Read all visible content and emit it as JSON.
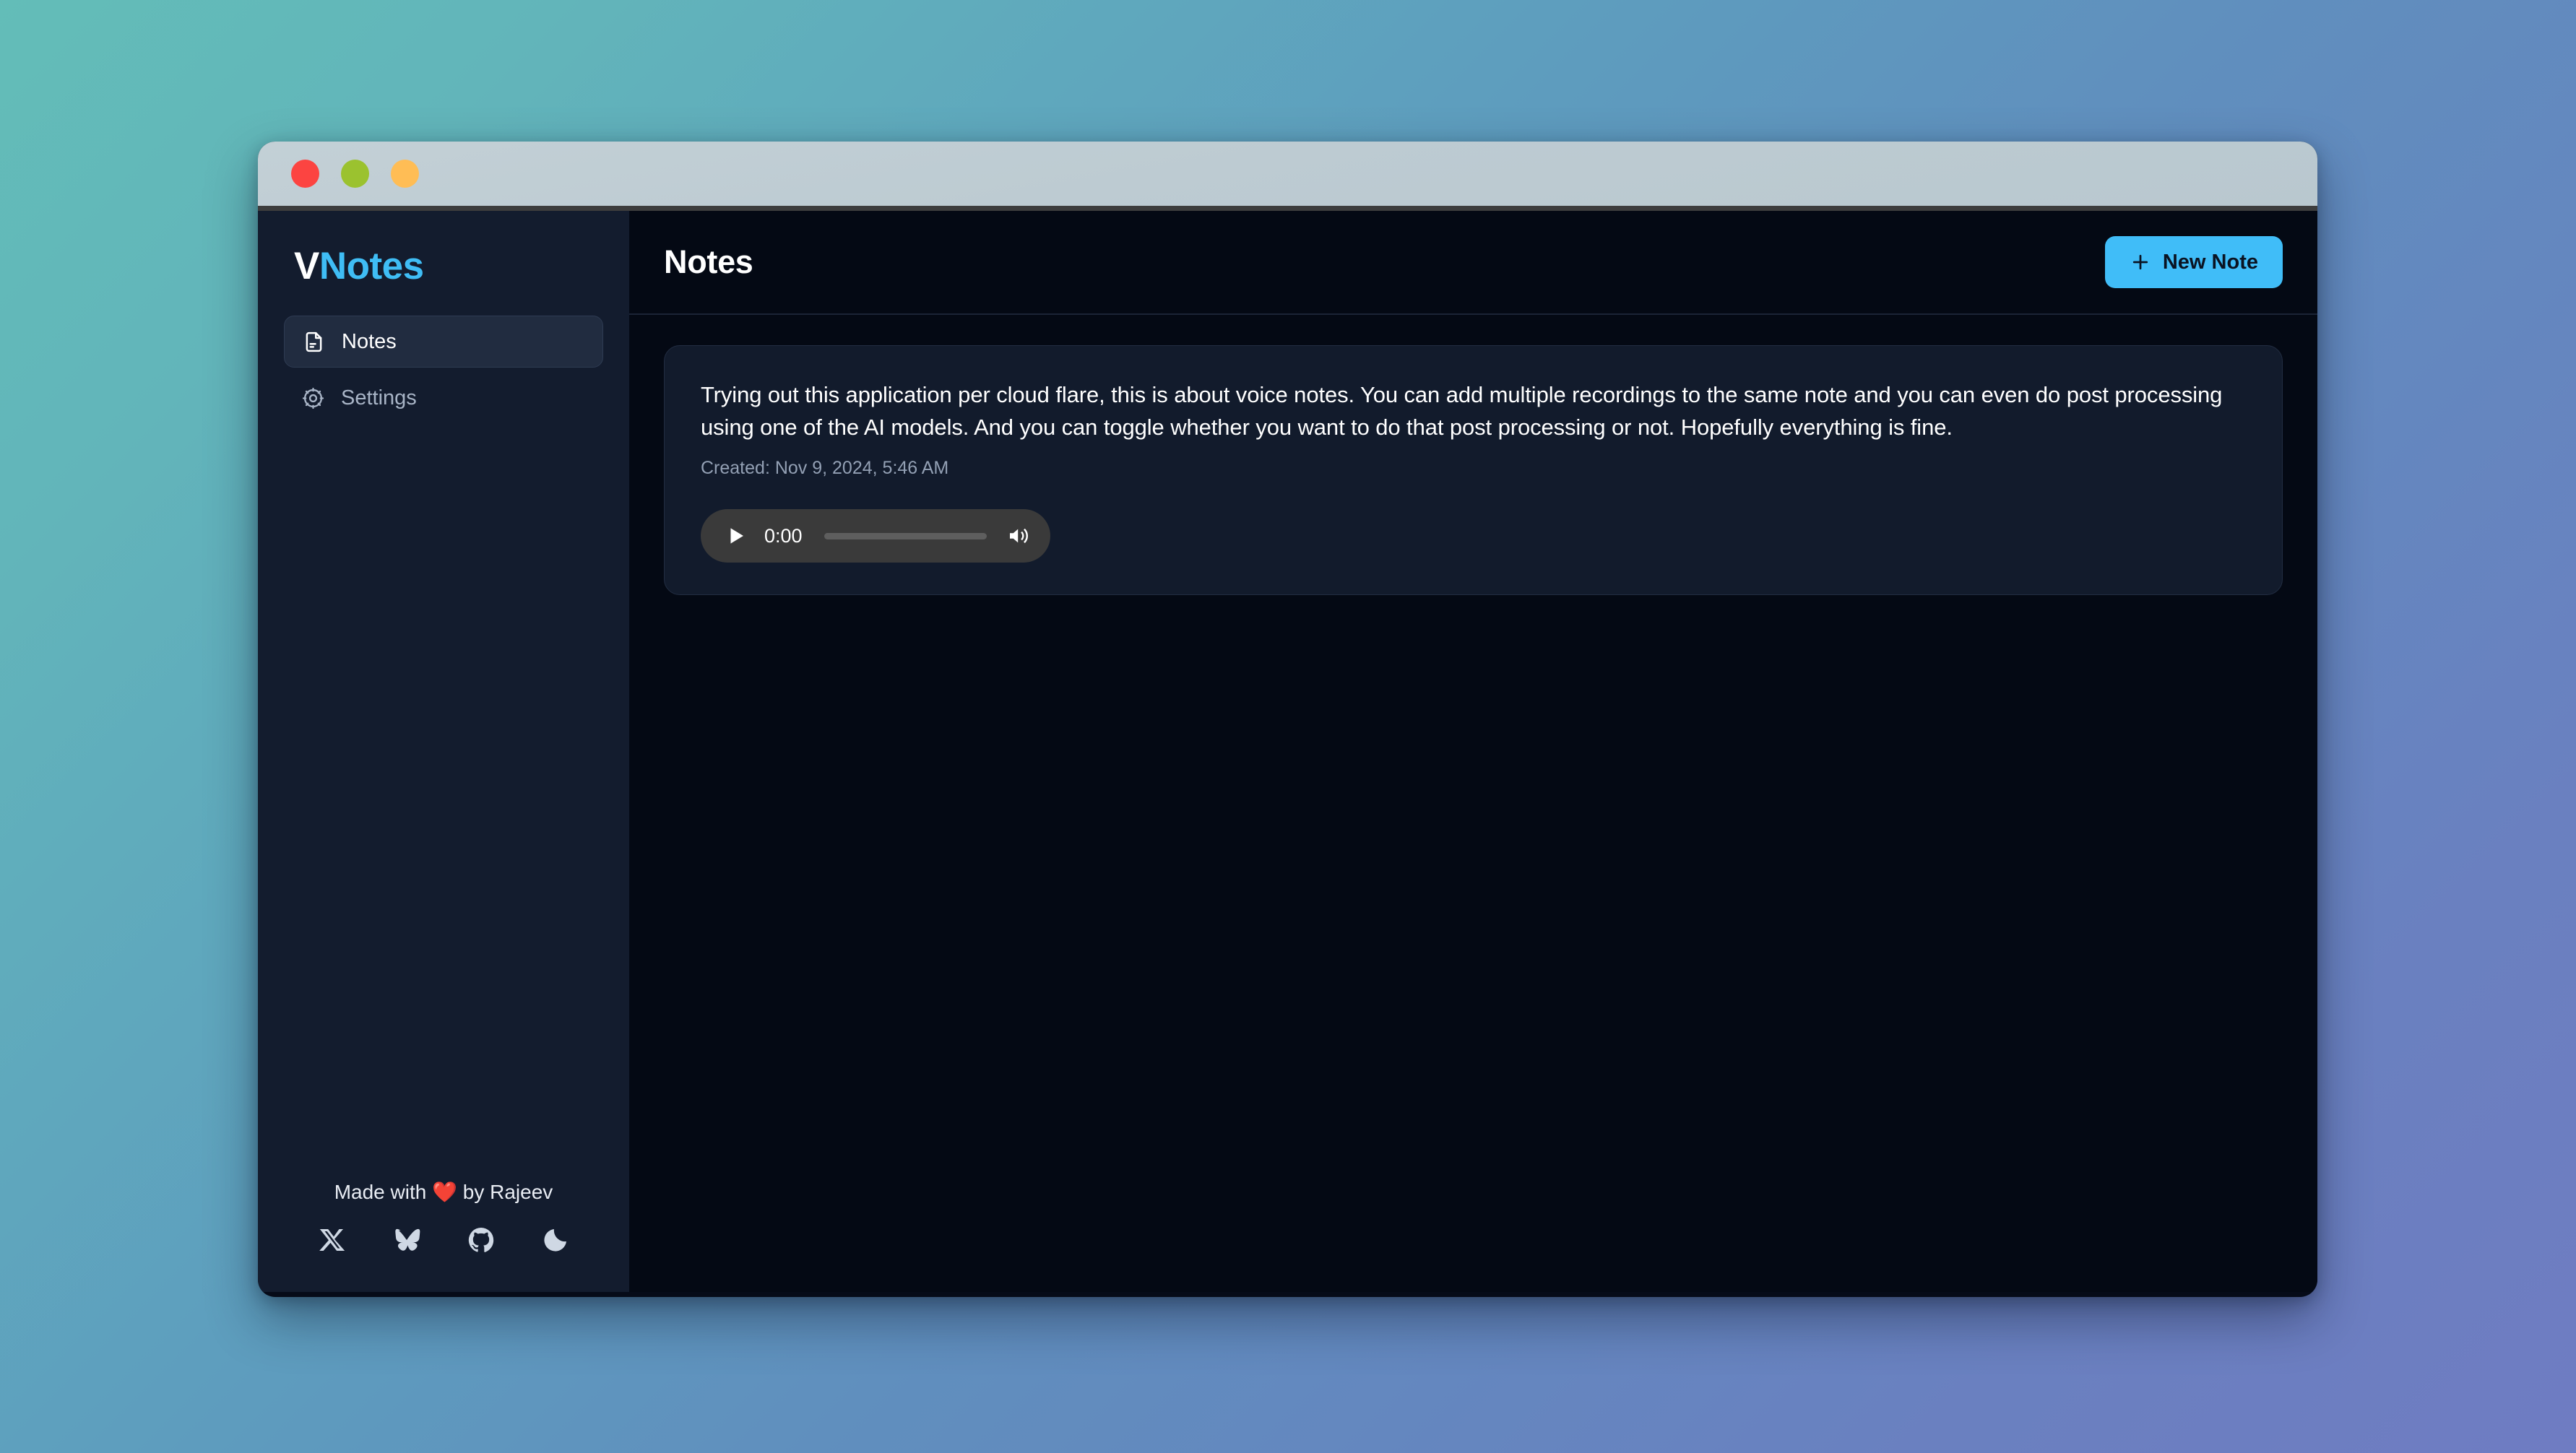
{
  "window": {
    "traffic_lights": [
      {
        "name": "close",
        "color": "#fc4441"
      },
      {
        "name": "minimize",
        "color": "#9bc22f"
      },
      {
        "name": "zoom",
        "color": "#ffbd55"
      }
    ]
  },
  "sidebar": {
    "brand": {
      "prefix": "V",
      "suffix": "Notes",
      "accent_color": "#3fbdf5"
    },
    "items": [
      {
        "label": "Notes",
        "icon": "document-icon",
        "active": true
      },
      {
        "label": "Settings",
        "icon": "gear-icon",
        "active": false
      }
    ],
    "footer": {
      "made_with_prefix": "Made with ",
      "heart": "❤️",
      "made_with_suffix": " by Rajeev",
      "socials": [
        {
          "name": "x-twitter-icon",
          "label": "X"
        },
        {
          "name": "bluesky-icon",
          "label": "Bluesky"
        },
        {
          "name": "github-icon",
          "label": "GitHub"
        },
        {
          "name": "moon-icon",
          "label": "Dark mode"
        }
      ]
    }
  },
  "header": {
    "title": "Notes",
    "new_note_label": "New Note",
    "new_note_color": "#40bdf8"
  },
  "note": {
    "text": "Trying out this application per cloud flare, this is about voice notes. You can add multiple recordings to the same note and you can even do post processing using one of the AI models. And you can toggle whether you want to do that post processing or not. Hopefully everything is fine.",
    "created": "Created: Nov 9, 2024, 5:46 AM",
    "audio": {
      "current_time": "0:00",
      "progress_percent": 0
    }
  }
}
